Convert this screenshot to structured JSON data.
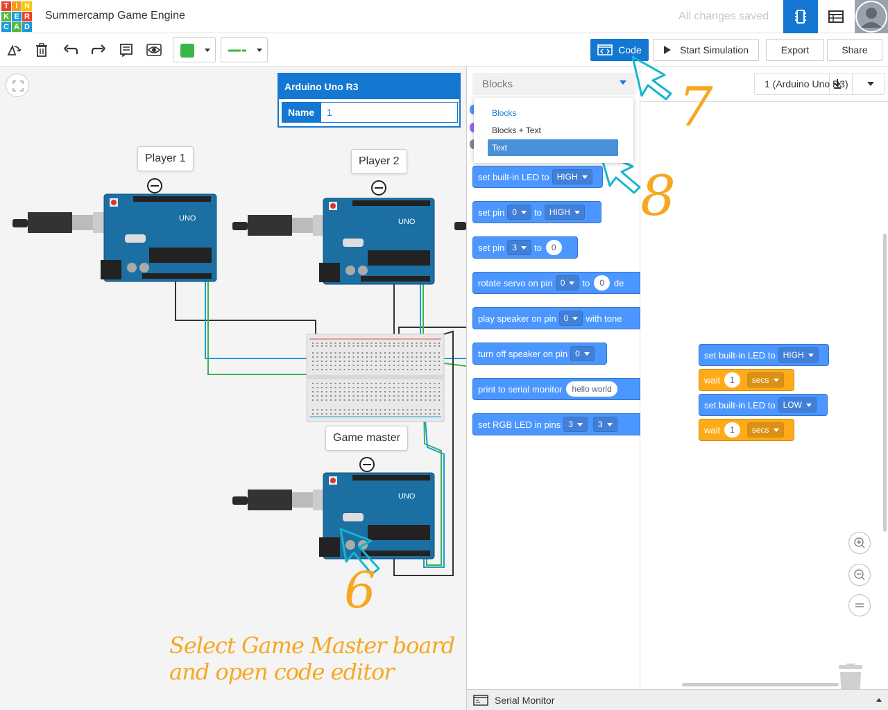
{
  "header": {
    "logo_letters": [
      "T",
      "I",
      "N",
      "K",
      "E",
      "R",
      "C",
      "A",
      "D"
    ],
    "logo_colors": [
      "#e8452c",
      "#f59b1b",
      "#fbc600",
      "#54b845",
      "#1a9bd7",
      "#e8452c",
      "#1a9bd7",
      "#54b845",
      "#1a9bd7"
    ],
    "title": "Summercamp Game Engine",
    "save_status": "All changes saved",
    "active_color": "#1477d1"
  },
  "toolbar": {
    "color_swatch": "#3bb44a",
    "code_label": "Code",
    "simulate_label": "Start Simulation",
    "export_label": "Export",
    "share_label": "Share"
  },
  "inspector": {
    "title": "Arduino Uno R3",
    "name_label": "Name",
    "name_value": "1"
  },
  "canvas": {
    "labels": [
      "Player 1",
      "Player 2",
      "Game master"
    ],
    "board_text": "UNO",
    "instruction": "Select Game Master board and open code editor",
    "step_numbers": [
      "6",
      "7",
      "8"
    ]
  },
  "editor": {
    "mode_select": "Blocks",
    "mode_options": [
      "Blocks",
      "Blocks + Text",
      "Text"
    ],
    "selected_mode": "Text",
    "device_select": "1 (Arduino Uno R3)",
    "serial_monitor": "Serial Monitor",
    "palette": {
      "b1": {
        "text": "set built-in LED to",
        "dd": "HIGH"
      },
      "b2": {
        "text1": "set pin",
        "dd1": "0",
        "text2": "to",
        "dd2": "HIGH"
      },
      "b3": {
        "text1": "set pin",
        "dd1": "3",
        "text2": "to",
        "val": "0"
      },
      "b4": {
        "text1": "rotate servo on pin",
        "dd1": "0",
        "text2": "to",
        "val": "0",
        "text3": "de"
      },
      "b5": {
        "text1": "play speaker on pin",
        "dd1": "0",
        "text2": "with tone"
      },
      "b6": {
        "text1": "turn off speaker on pin",
        "dd1": "0"
      },
      "b7": {
        "text1": "print to serial monitor",
        "val": "hello world"
      },
      "b8": {
        "text1": "set RGB LED in pins",
        "dd1": "3",
        "dd2": "3"
      }
    },
    "script": {
      "s1": {
        "text": "set built-in LED to",
        "dd": "HIGH"
      },
      "s2": {
        "text": "wait",
        "val": "1",
        "dd": "secs"
      },
      "s3": {
        "text": "set built-in LED to",
        "dd": "LOW"
      },
      "s4": {
        "text": "wait",
        "val": "1",
        "dd": "secs"
      }
    }
  }
}
